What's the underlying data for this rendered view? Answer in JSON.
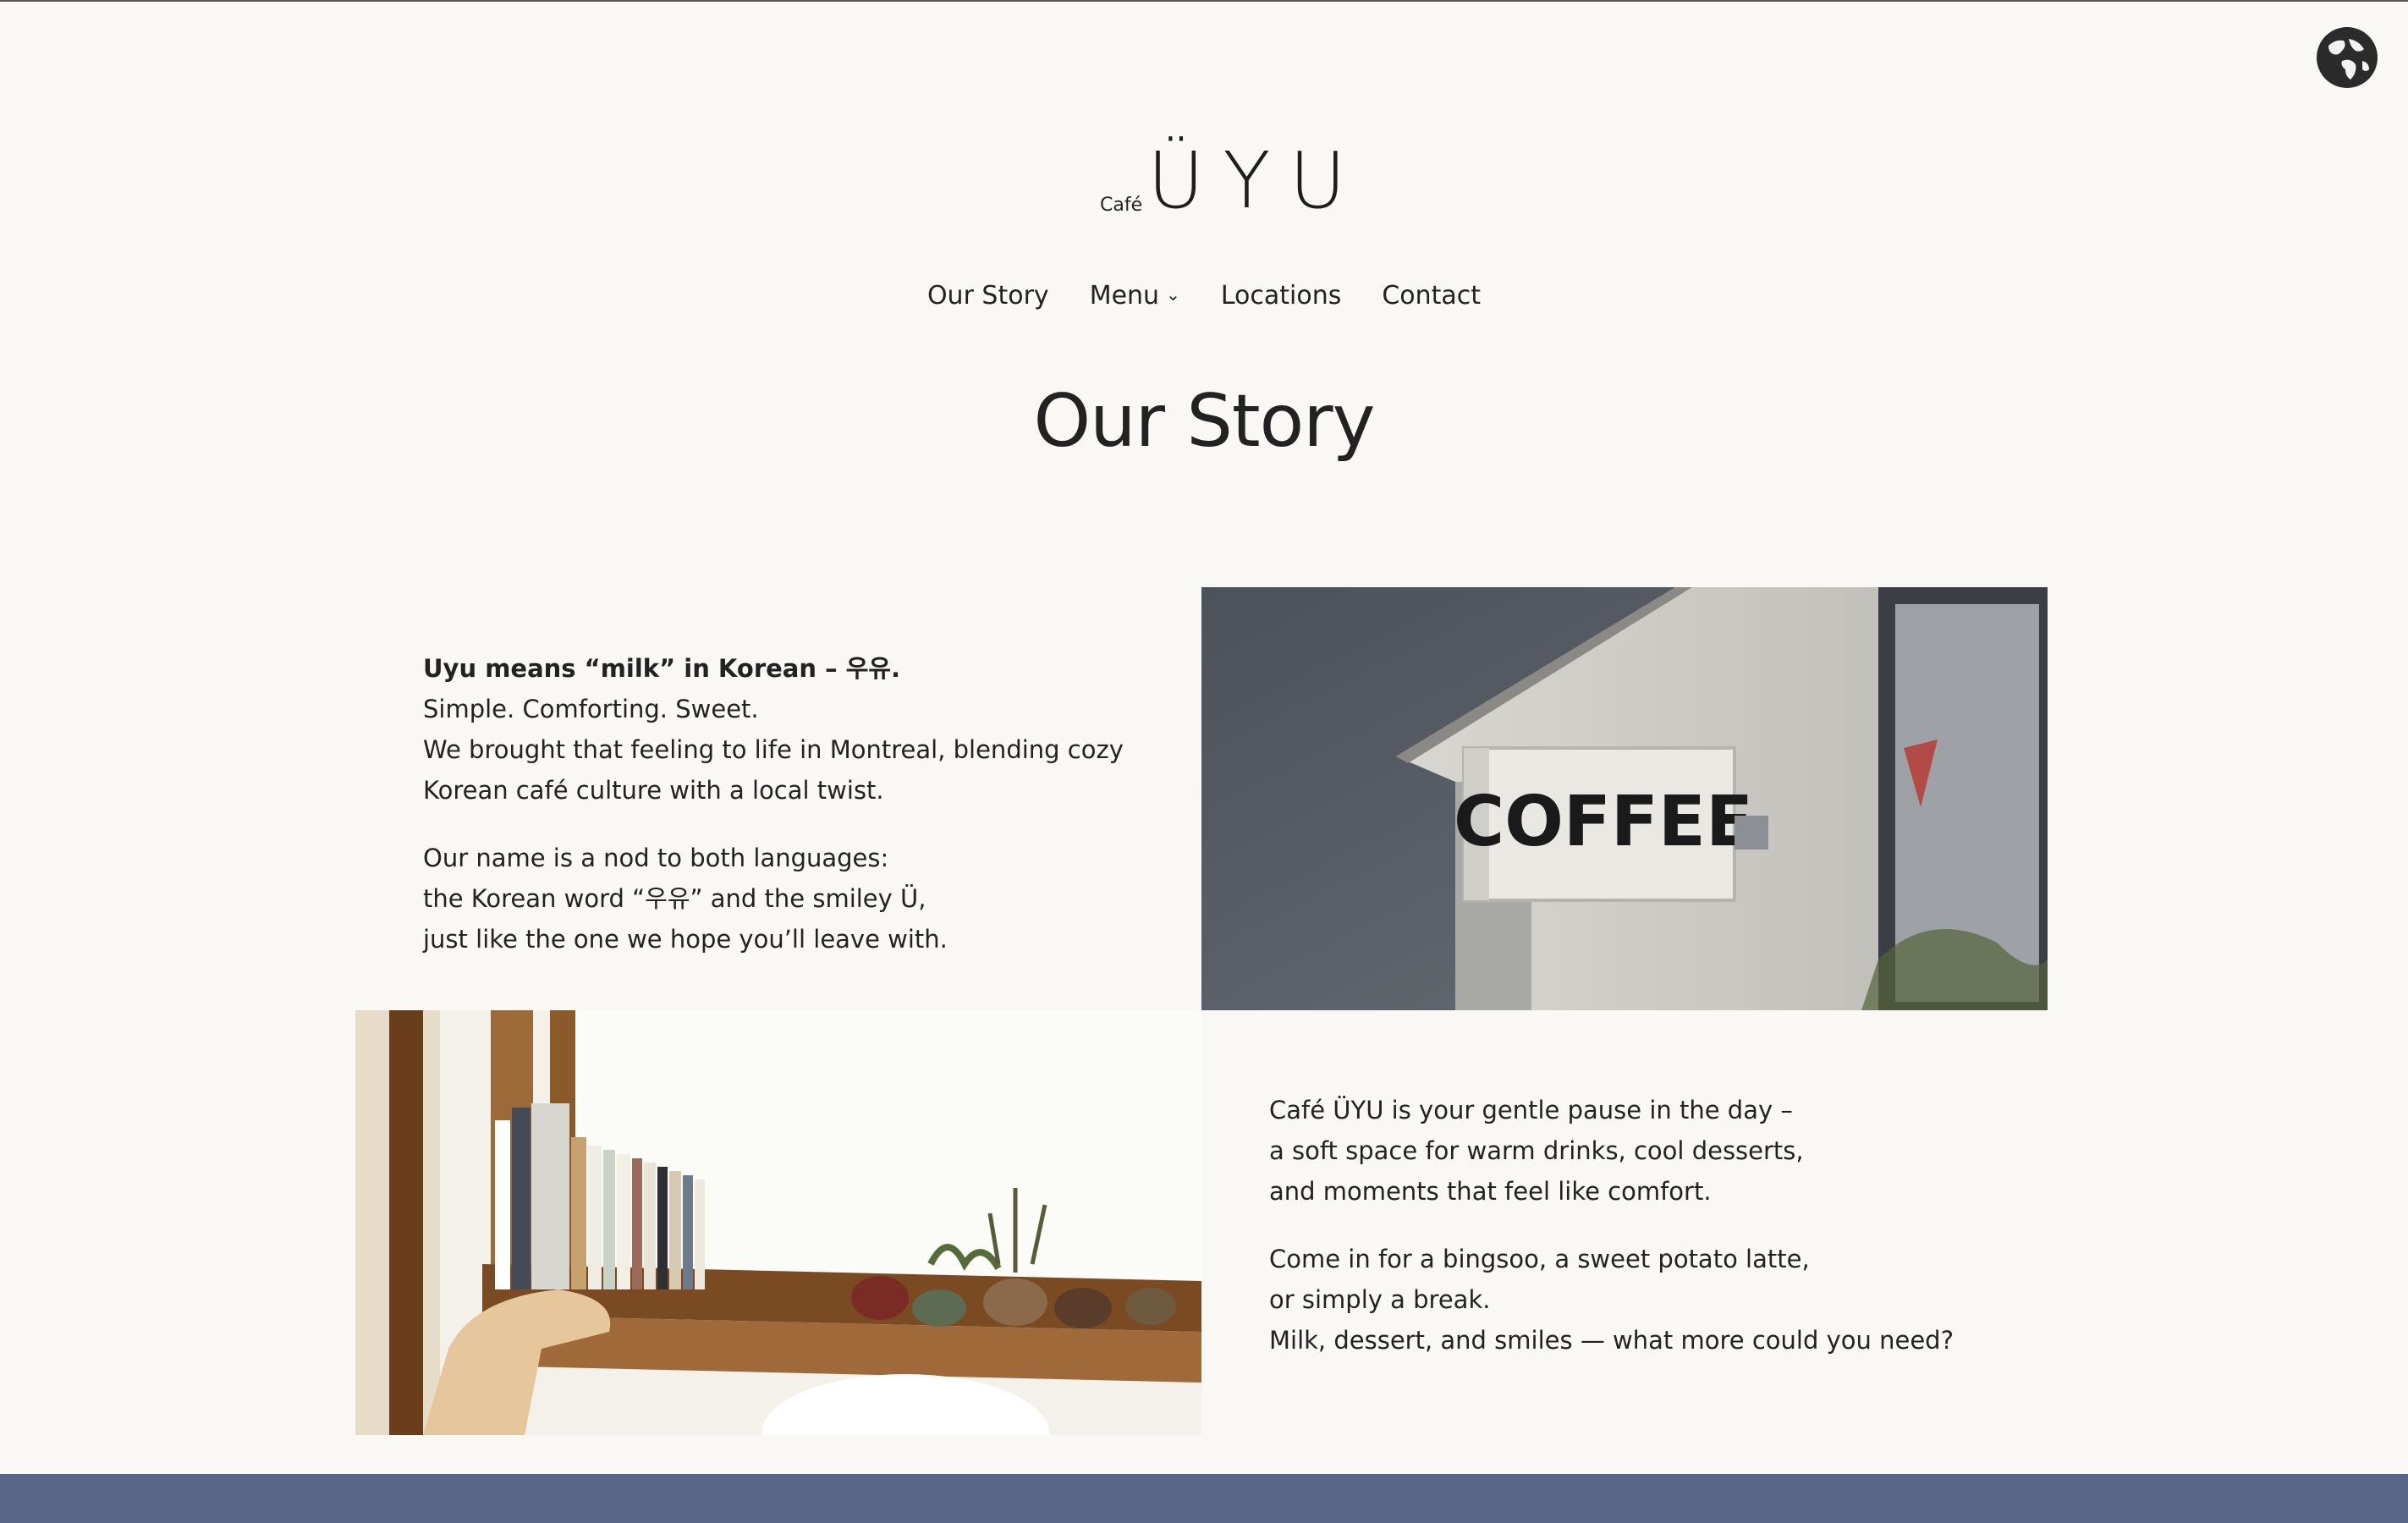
{
  "header": {
    "logo_small": "Café",
    "logo_main": "ÜYU",
    "language_icon": "globe-icon"
  },
  "nav": {
    "items": [
      {
        "label": "Our Story"
      },
      {
        "label": "Menu"
      },
      {
        "label": "Locations"
      },
      {
        "label": "Contact"
      }
    ]
  },
  "page": {
    "title": "Our Story"
  },
  "section_a": {
    "lead": "Uyu means “milk” in Korean – 우유.",
    "lines": [
      "Simple. Comforting. Sweet.",
      "We brought that feeling to life in Montreal, blending cozy",
      "Korean café culture with a local twist."
    ],
    "para2": [
      "Our name is a nod to both languages:",
      "the Korean word “우유” and the smiley Ü,",
      "just like the one we hope you’ll leave with."
    ]
  },
  "section_b": {
    "para1": [
      "Café ÜYU is your gentle pause in the day –",
      "a soft space for warm drinks, cool desserts,",
      "and moments that feel like comfort."
    ],
    "para2": [
      "Come in for a bingsoo, a sweet potato latte,",
      "or simply a break.",
      "Milk, dessert, and smiles — what more could you need?"
    ]
  },
  "images": {
    "coffee_sign_text": "COFFEE"
  },
  "colors": {
    "background": "#f9f8f5",
    "footer": "#5a6688",
    "text": "#222222"
  }
}
